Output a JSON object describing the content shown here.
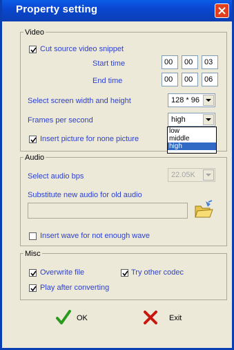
{
  "window": {
    "title": "Property setting"
  },
  "video": {
    "group_label": "Video",
    "cut_snippet_label": "Cut source video snippet",
    "start_time_label": "Start time",
    "start_time": [
      "00",
      "00",
      "03"
    ],
    "end_time_label": "End time",
    "end_time": [
      "00",
      "00",
      "06"
    ],
    "screen_size_label": "Select screen width and height",
    "screen_size_value": "128 * 96",
    "fps_label": "Frames per second",
    "fps_value": "high",
    "fps_options": [
      "low",
      "middle",
      "high"
    ],
    "insert_picture_label": "Insert picture for none picture"
  },
  "audio": {
    "group_label": "Audio",
    "bps_label": "Select audio bps",
    "bps_value": "22.05K",
    "substitute_label": "Substitute new audio for old audio",
    "audio_path": "",
    "insert_wave_label": "Insert wave for not enough wave"
  },
  "misc": {
    "group_label": "Misc",
    "overwrite_label": "Overwrite file",
    "try_codec_label": "Try other codec",
    "play_after_label": "Play after converting"
  },
  "buttons": {
    "ok_label": "OK",
    "exit_label": "Exit"
  },
  "colors": {
    "title_bar": "#0a47d1",
    "label_text": "#2c3fd1",
    "close_button": "#e0401e",
    "ok_check": "#2a9a1e",
    "exit_x": "#c8160c"
  }
}
